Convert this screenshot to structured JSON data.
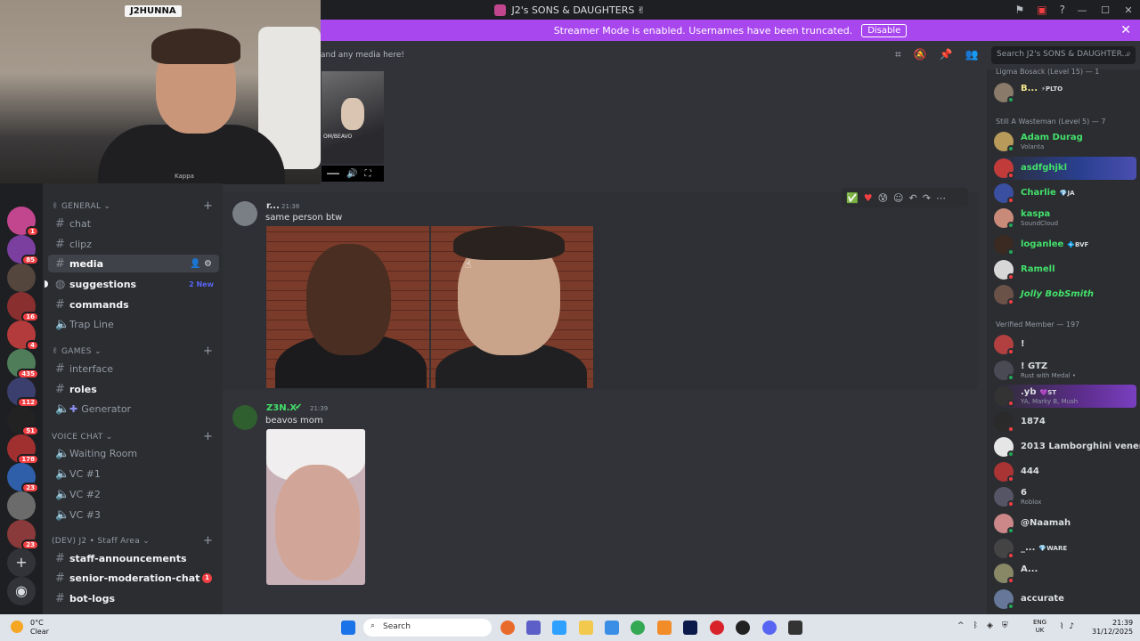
{
  "window": {
    "title": "J2's SONS & DAUGHTERS",
    "title_emoji": "✌"
  },
  "streamer_banner": {
    "text": "Streamer Mode is enabled. Usernames have been truncated.",
    "button": "Disable"
  },
  "webcam": {
    "label": "J2HUNNA",
    "shirt_text": "Kappa"
  },
  "channel_header": {
    "topic": "and any media here!",
    "search_placeholder": "Search J2's SONS & DAUGHTER..."
  },
  "server_rail": {
    "badges": [
      "112",
      "1",
      "85",
      "",
      "16",
      "4",
      "435",
      "112",
      "51",
      "178",
      "23",
      "",
      "23"
    ]
  },
  "sidebar": {
    "categories": [
      {
        "name": "GENERAL",
        "emoji": "✌"
      },
      {
        "name": "GAMES",
        "emoji": "✌"
      },
      {
        "name": "VOICE CHAT"
      },
      {
        "name": "(DEV) J2 • Staff Area"
      }
    ],
    "channels": {
      "chat": "chat",
      "clipz": "clipz",
      "media": "media",
      "suggestions": "suggestions",
      "suggestions_new": "2 New",
      "commands": "commands",
      "trap_line": "Trap Line",
      "interface": "interface",
      "roles": "roles",
      "generator": "Generator",
      "waiting_room": "Waiting Room",
      "vc1": "VC #1",
      "vc2": "VC #2",
      "vc3": "VC #3",
      "staff_announcements": "staff-announcements",
      "senior_moderation_chat": "senior-moderation-chat",
      "senior_mention_count": "1",
      "bot_logs": "bot-logs"
    }
  },
  "messages": [
    {
      "author": "r...",
      "time": "21:38",
      "text": "same person btw"
    },
    {
      "author": "Z3N.X",
      "time": "21:39",
      "text": "beavos mom"
    }
  ],
  "video_embed": {
    "overlay_text": "OM/BEAVO"
  },
  "members": {
    "groups": [
      {
        "label": "Ligma Bosack (Level 15) — 1"
      },
      {
        "label": "Still A Wasteman (Level 5) — 7"
      },
      {
        "label": "Verified Member — 197"
      }
    ],
    "list": [
      {
        "name": "B...",
        "tag": "PLTO",
        "color": "#f0e68c"
      },
      {
        "name": "Adam Durag",
        "status": "Volanta",
        "color": "#43e06a"
      },
      {
        "name": "asdfghjkl",
        "color": "#43e06a"
      },
      {
        "name": "Charlie",
        "tag": "JA",
        "color": "#43e06a"
      },
      {
        "name": "kaspa",
        "status": "SoundCloud",
        "color": "#43e06a"
      },
      {
        "name": "loganlee",
        "tag": "BVF",
        "color": "#43e06a"
      },
      {
        "name": "Ramell",
        "color": "#43e06a"
      },
      {
        "name": "Jolly BobSmith",
        "color": "#43e06a"
      },
      {
        "name": "!",
        "color": "#dbdee1"
      },
      {
        "name": "! GTZ",
        "status": "Rust with Medal •",
        "color": "#dbdee1"
      },
      {
        "name": ".yb",
        "tag": "ST",
        "status": "YA, Marky B, Mush",
        "color": "#dbdee1"
      },
      {
        "name": "1874",
        "color": "#dbdee1"
      },
      {
        "name": "2013 Lamborghini veneno",
        "color": "#dbdee1"
      },
      {
        "name": "444",
        "color": "#dbdee1"
      },
      {
        "name": "6",
        "status": "Roblox",
        "color": "#dbdee1"
      },
      {
        "name": "@Naamah",
        "color": "#dbdee1"
      },
      {
        "name": "_...",
        "tag": "WARE",
        "color": "#dbdee1"
      },
      {
        "name": "A...",
        "color": "#dbdee1"
      },
      {
        "name": "accurate",
        "color": "#dbdee1"
      }
    ]
  },
  "taskbar": {
    "weather_temp": "0°C",
    "weather_desc": "Clear",
    "search": "Search",
    "lang_top": "ENG",
    "lang_bottom": "UK",
    "time": "21:39",
    "date": "31/12/2025"
  }
}
